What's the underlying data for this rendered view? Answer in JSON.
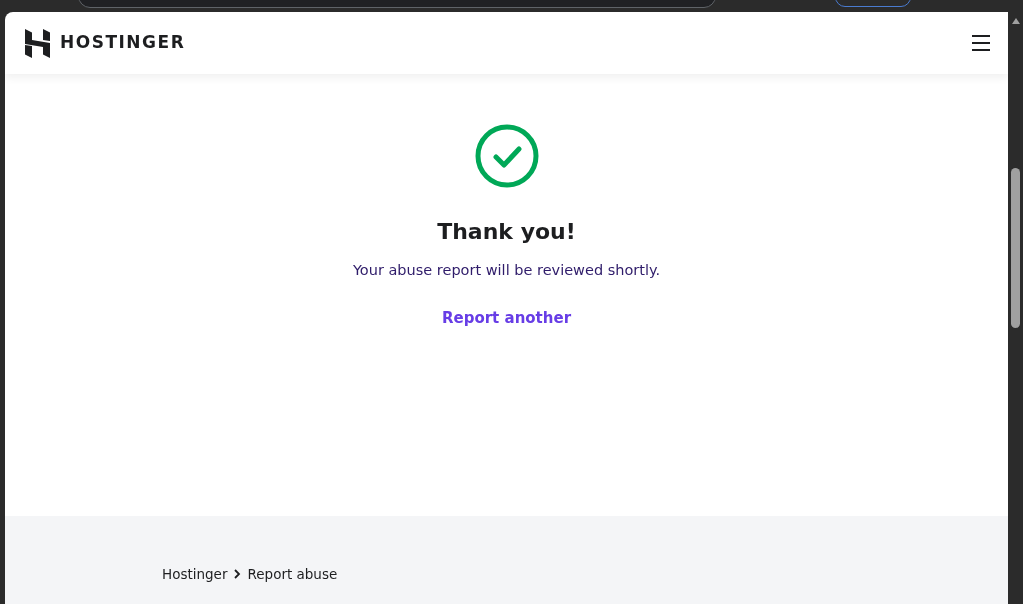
{
  "header": {
    "brand": "HOSTINGER"
  },
  "confirmation": {
    "title": "Thank you!",
    "message": "Your abuse report will be reviewed shortly.",
    "link": "Report another"
  },
  "breadcrumbs": [
    {
      "label": "Hostinger"
    },
    {
      "label": "Report abuse"
    }
  ]
}
